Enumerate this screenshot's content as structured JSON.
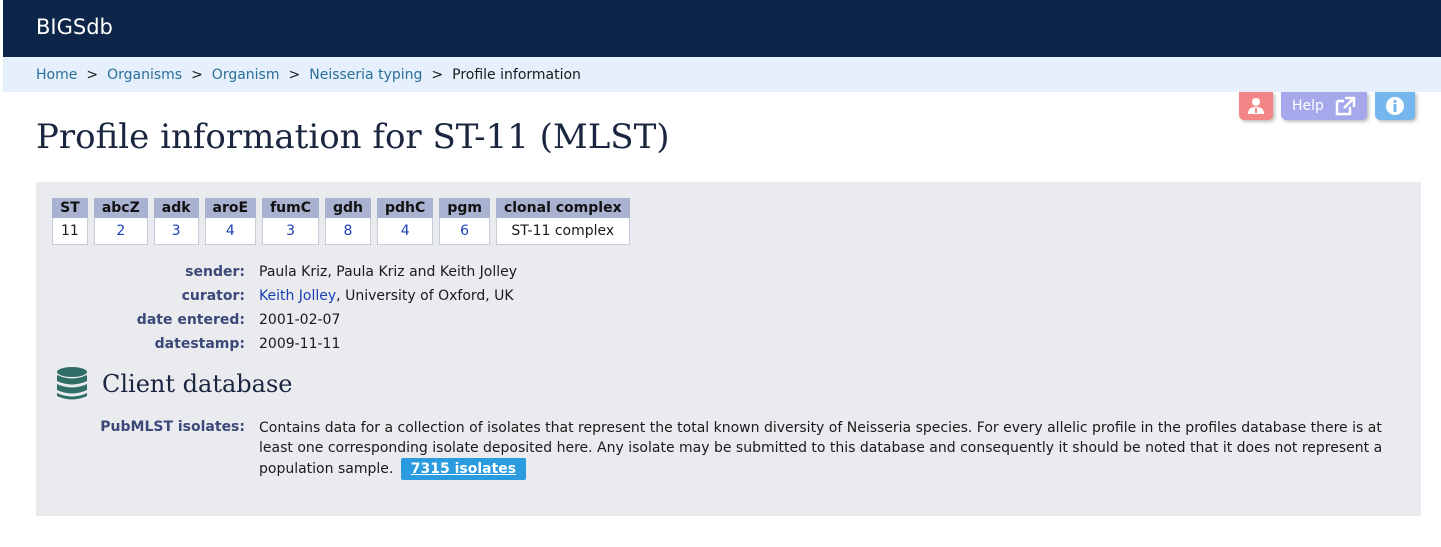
{
  "header": {
    "app_name": "BIGSdb"
  },
  "breadcrumb": {
    "items": [
      "Home",
      "Organisms",
      "Organism",
      "Neisseria typing"
    ],
    "separator": ">",
    "current": "Profile information"
  },
  "top_buttons": {
    "login_icon": "user-icon",
    "help_label": "Help",
    "help_icon": "external-link-icon",
    "info_icon": "info-icon"
  },
  "page_title": "Profile information for ST-11 (MLST)",
  "profile_table": {
    "headers": [
      "ST",
      "abcZ",
      "adk",
      "aroE",
      "fumC",
      "gdh",
      "pdhC",
      "pgm",
      "clonal complex"
    ],
    "values": [
      "11",
      "2",
      "3",
      "4",
      "3",
      "8",
      "4",
      "6",
      "ST-11 complex"
    ]
  },
  "fields": {
    "sender_label": "sender:",
    "sender_value": "Paula Kriz, Paula Kriz and Keith Jolley",
    "curator_label": "curator:",
    "curator_name": "Keith Jolley",
    "curator_affiliation": ", University of Oxford, UK",
    "date_entered_label": "date entered:",
    "date_entered_value": "2001-02-07",
    "datestamp_label": "datestamp:",
    "datestamp_value": "2009-11-11"
  },
  "client_database": {
    "heading": "Client database",
    "icon": "database-icon",
    "label": "PubMLST isolates:",
    "description": "Contains data for a collection of isolates that represent the total known diversity of Neisseria species. For every allelic profile in the profiles database there is at least one corresponding isolate deposited here. Any isolate may be submitted to this database and consequently it should be noted that it does not represent a population sample.",
    "button_label": "7315 isolates"
  },
  "colors": {
    "header_bg": "#0c2548",
    "breadcrumb_bg": "#e6effc",
    "link": "#2a6f97",
    "table_header_bg": "#a9b2d1",
    "isolates_button": "#2a9bde"
  }
}
